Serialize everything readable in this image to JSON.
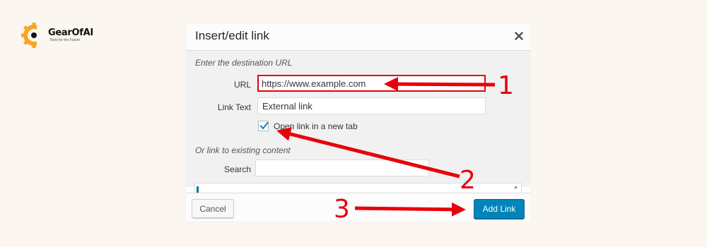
{
  "brand": {
    "name": "GearOfAI",
    "tagline": "Tools for the Future",
    "logo_icon": "gear-icon",
    "logo_colors": [
      "#f5a623",
      "#111111"
    ]
  },
  "dialog": {
    "title": "Insert/edit link",
    "close_icon": "close-icon",
    "destination_section": "Enter the destination URL",
    "url_label": "URL",
    "url_value": "https://www.example.com",
    "link_text_label": "Link Text",
    "link_text_value": "External link",
    "new_tab_label": "Open link in a new tab",
    "new_tab_checked": true,
    "existing_section": "Or link to existing content",
    "search_label": "Search",
    "search_value": "",
    "cancel_label": "Cancel",
    "add_link_label": "Add Link",
    "accent_color": "#0085ba"
  },
  "annotations": {
    "color": "#e8000b",
    "steps": [
      "1",
      "2",
      "3"
    ]
  }
}
